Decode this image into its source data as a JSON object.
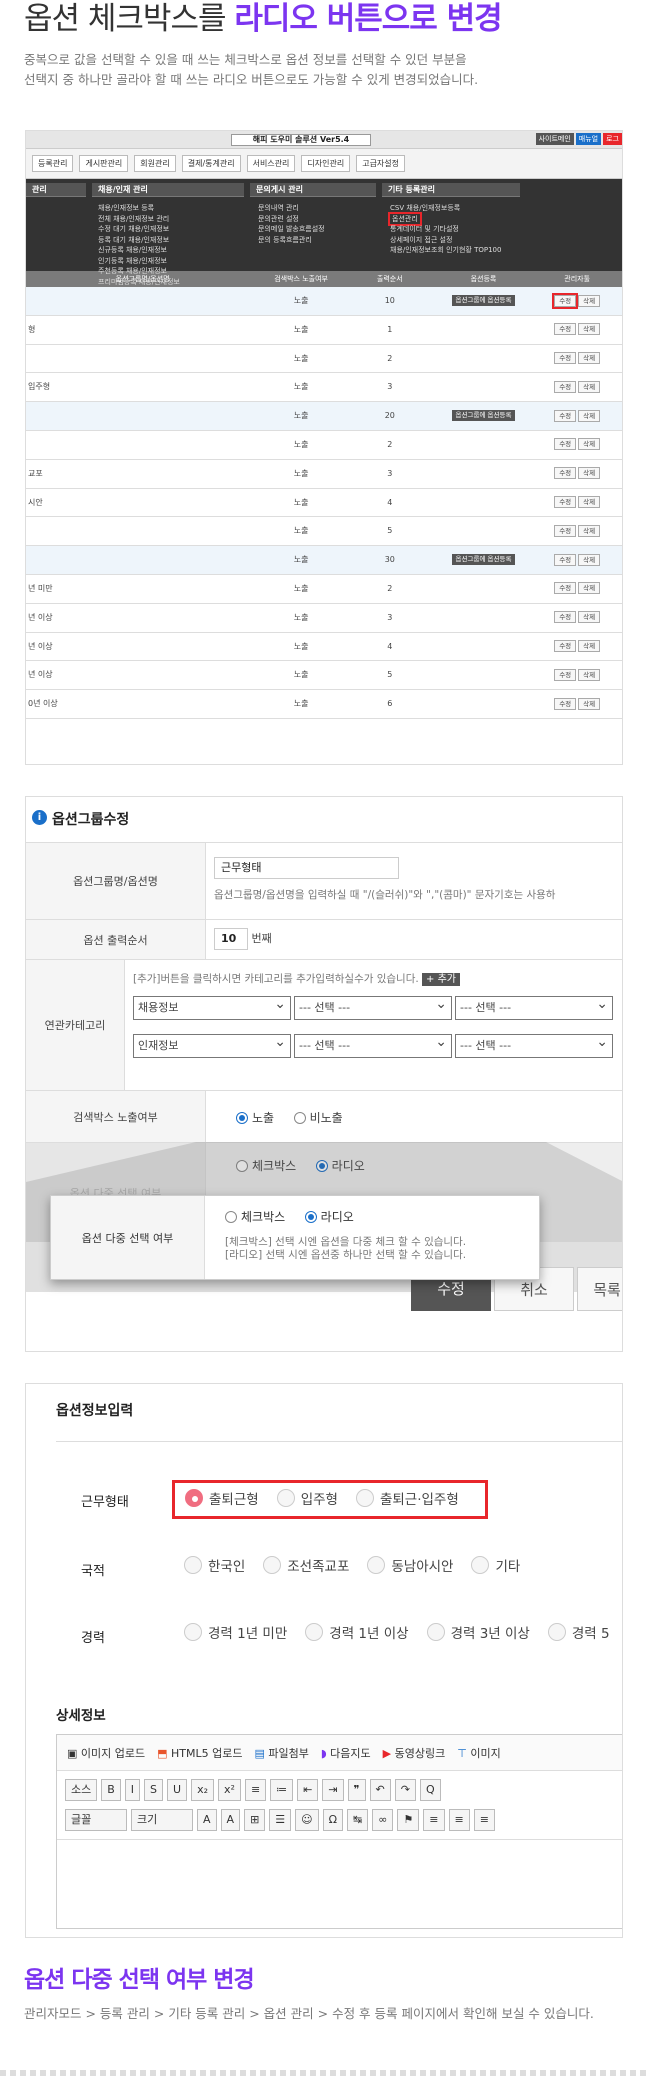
{
  "heading": {
    "prefix": "옵션 체크박스를",
    "highlight": "라디오 버튼으로 변경"
  },
  "description": [
    "중복으로 값을 선택할 수 있을 때 쓰는 체크박스로 옵션 정보를 선택할 수 있던 부분을",
    "선택지 중 하나만 골라야 할 때 쓰는 라디오 버튼으로도 가능할 수 있게 변경되었습니다."
  ],
  "admin": {
    "title": "해피 도우미 솔루션 Ver5.4",
    "top_buttons": [
      "사이트메인",
      "매뉴얼",
      "로그"
    ],
    "menu": [
      "등록관리",
      "게시판관리",
      "회원관리",
      "결제/통계관리",
      "서비스관리",
      "디자인관리",
      "고급자설정"
    ],
    "dropdown_cats": [
      "관리",
      "채용/인재 관리",
      "문의게시 관리",
      "기타 등록관리"
    ],
    "dropdown_cols": [
      [
        "채용/인재정보 등록",
        "전체 채용/인재정보 관리",
        "수정 대기 채용/인재정보",
        "등록 대기 채용/인재정보",
        "신규등록 채용/인재정보",
        "인기등록 채용/인재정보",
        "주천등록 채용/인재정보",
        "프리미엄등록 채용/인재정보"
      ],
      [
        "문의내역 관리",
        "문의관련 설정",
        "문의메일 발송흐름설정",
        "문의 등록흐름관리"
      ],
      [
        "CSV 채용/인재정보등록",
        "옵션관리",
        "통계데이터 및 기타설정",
        "상세페이지 접근 설정",
        "채용/인재정보조회 인기현황 TOP100"
      ]
    ],
    "table_headers": [
      "옵션그룹명/옵션명",
      "검색박스 노출여부",
      "출력순서",
      "옵션등록",
      "관리자툴"
    ],
    "group_button": "옵션그룹에 옵션등록",
    "edit_label": "수정",
    "delete_label": "삭제",
    "rows": [
      {
        "name": "",
        "show": "노출",
        "order": "10",
        "group": true
      },
      {
        "name": "형",
        "show": "노출",
        "order": "1",
        "group": false
      },
      {
        "name": "",
        "show": "노출",
        "order": "2",
        "group": false
      },
      {
        "name": "입주형",
        "show": "노출",
        "order": "3",
        "group": false
      },
      {
        "name": "",
        "show": "노출",
        "order": "20",
        "group": true
      },
      {
        "name": "",
        "show": "노출",
        "order": "2",
        "group": false
      },
      {
        "name": "교포",
        "show": "노출",
        "order": "3",
        "group": false
      },
      {
        "name": "시안",
        "show": "노출",
        "order": "4",
        "group": false
      },
      {
        "name": "",
        "show": "노출",
        "order": "5",
        "group": false
      },
      {
        "name": "",
        "show": "노출",
        "order": "30",
        "group": true
      },
      {
        "name": "년 미만",
        "show": "노출",
        "order": "2",
        "group": false
      },
      {
        "name": "년 이상",
        "show": "노출",
        "order": "3",
        "group": false
      },
      {
        "name": "년 이상",
        "show": "노출",
        "order": "4",
        "group": false
      },
      {
        "name": "년 이상",
        "show": "노출",
        "order": "5",
        "group": false
      },
      {
        "name": "0년 이상",
        "show": "노출",
        "order": "6",
        "group": false
      }
    ]
  },
  "edit_form": {
    "title": "옵션그룹수정",
    "name_label": "옵션그룹명/옵션명",
    "name_value": "근무형태",
    "name_hint": "옵션그룹명/옵션명을 입력하실 때 \"/(슬러쉬)\"와 \",\"(콤마)\" 문자기호는 사용하",
    "order_label": "옵션 출력순서",
    "order_value": "10",
    "order_unit": "번째",
    "cat_label": "연관카테고리",
    "cat_hint": "[추가]버튼을 클릭하시면 카테고리를 추가입력하실수가 있습니다.",
    "cat_add": "+ 추가",
    "cat_rows": [
      [
        "채용정보",
        "--- 선택 ---",
        "--- 선택 ---"
      ],
      [
        "인재정보",
        "--- 선택 ---",
        "--- 선택 ---"
      ]
    ],
    "search_label": "검색박스 노출여부",
    "search_opts": [
      "노출",
      "비노출"
    ],
    "multi_label": "옵션 다중 선택 여부",
    "multi_opts": [
      "체크박스",
      "라디오"
    ],
    "multi_hint": [
      "[체크박스] 선택 시엔 옵션을 다중 체크 할 수 있습니다.",
      "[라디오] 선택 시엔 옵션중 하나만 선택 할 수 있습니다."
    ],
    "buttons": [
      "수정",
      "취소",
      "목록"
    ]
  },
  "info_form": {
    "title": "옵션정보입력",
    "groups": [
      {
        "label": "근무형태",
        "opts": [
          "출퇴근형",
          "입주형",
          "출퇴근·입주형"
        ],
        "selected": 0
      },
      {
        "label": "국적",
        "opts": [
          "한국인",
          "조선족교포",
          "동남아시안",
          "기타"
        ],
        "selected": -1
      },
      {
        "label": "경력",
        "opts": [
          "경력 1년 미만",
          "경력 1년 이상",
          "경력 3년 이상",
          "경력 5"
        ],
        "selected": -1
      }
    ],
    "detail_title": "상세정보",
    "toolbar1": [
      "이미지 업로드",
      "HTML5 업로드",
      "파일첨부",
      "다음지도",
      "동영상링크",
      "이미지"
    ],
    "toolbar2": [
      "소스",
      "B",
      "I",
      "S",
      "U",
      "x₂",
      "x²",
      "≡",
      "≔",
      "⇤",
      "⇥",
      "❞",
      "↶",
      "↷",
      "Q"
    ],
    "toolbar3": [
      "글꼴",
      "크기",
      "A",
      "A",
      "⊞",
      "☰",
      "☺",
      "Ω",
      "↹",
      "∞",
      "⚑",
      "≡",
      "≡",
      "≡"
    ]
  },
  "footer": {
    "title": "옵션 다중 선택 여부 변경",
    "path": "관리자모드 > 등록 관리 > 기타 등록 관리 > 옵션 관리 > 수정 후 등록 페이지에서 확인해 보실 수 있습니다."
  },
  "colors": {
    "accent": "#7c35f0",
    "highlight_red": "#e8262b",
    "radio_pink": "#f06d80",
    "admin_dark": "#333333"
  }
}
